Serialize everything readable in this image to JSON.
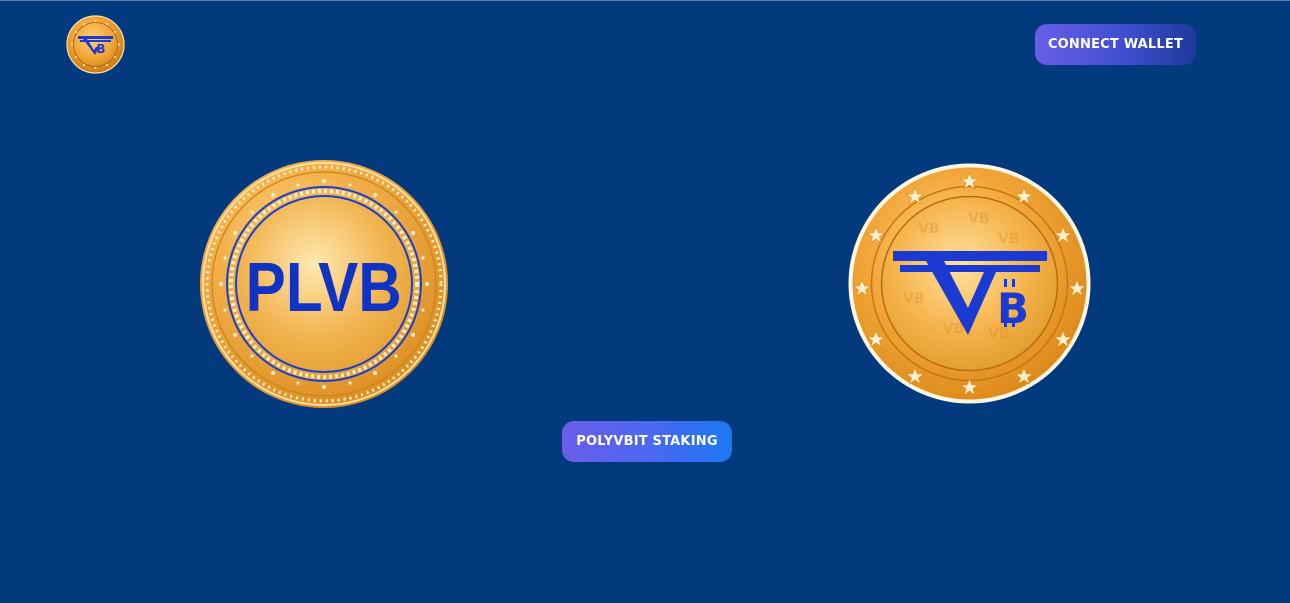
{
  "header": {
    "logo_alt": "PolyVBit logo",
    "connect_wallet_label": "CONNECT WALLET"
  },
  "main": {
    "left_coin_text": "PLVB",
    "staking_button_label": "POLYVBIT STAKING"
  },
  "colors": {
    "background": "#023a7d",
    "gold": "#f1a93a",
    "coin_blue": "#1033c4",
    "button_start": "#6a5ee8",
    "button_end": "#1c78f2"
  },
  "icons": {
    "logo": "vb-coin-logo-icon",
    "left_coin": "plvb-coin-icon",
    "right_coin": "vb-bitcoin-coin-icon"
  }
}
